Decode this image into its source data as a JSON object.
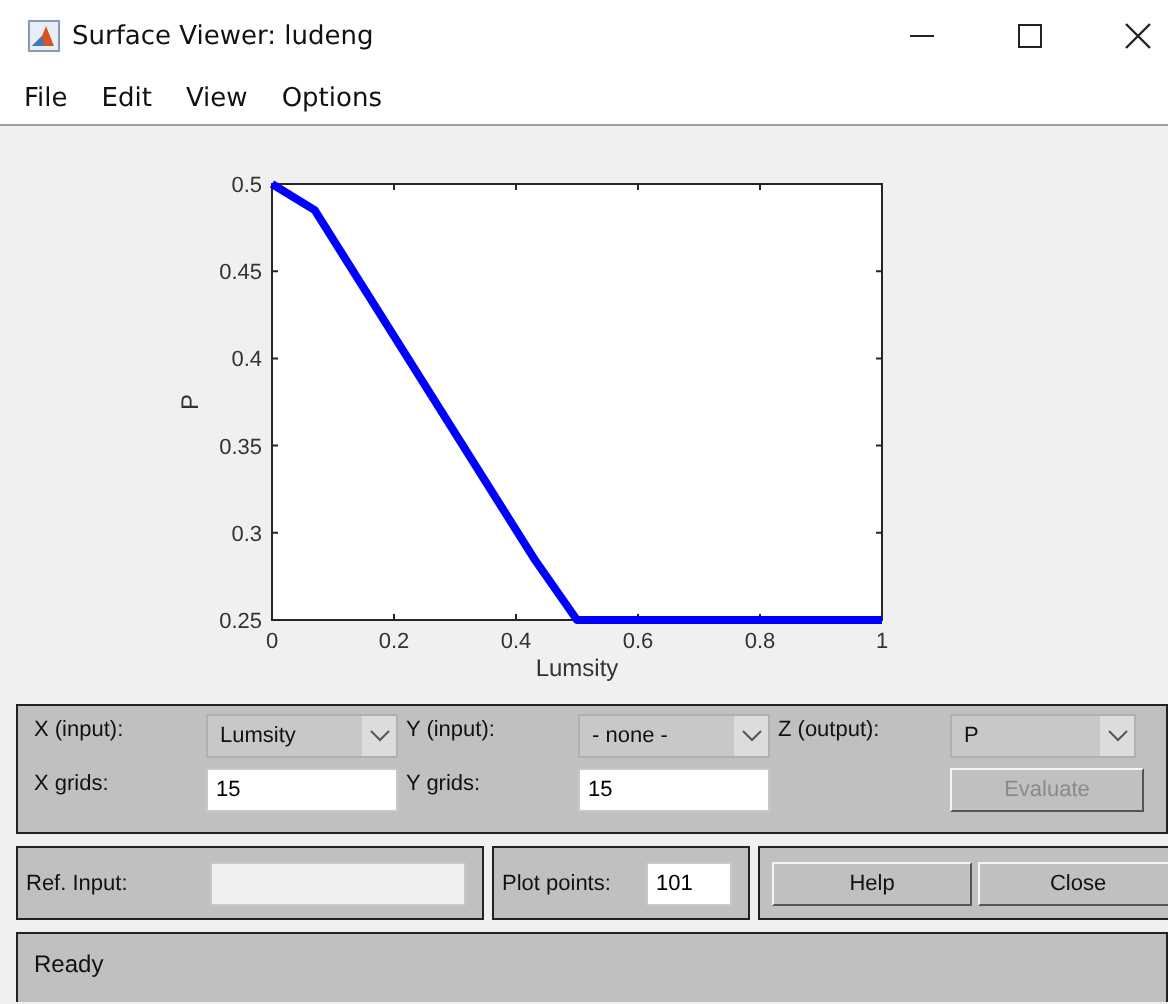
{
  "window": {
    "title": "Surface Viewer: ludeng"
  },
  "menu": [
    "File",
    "Edit",
    "View",
    "Options"
  ],
  "plot": {
    "chart_data": {
      "type": "line",
      "xlabel": "Lumsity",
      "ylabel": "P",
      "xlim": [
        0,
        1
      ],
      "ylim": [
        0.25,
        0.5
      ],
      "xticks": [
        0,
        0.2,
        0.4,
        0.6,
        0.8,
        1
      ],
      "yticks": [
        0.25,
        0.3,
        0.35,
        0.4,
        0.45,
        0.5
      ],
      "x": [
        0,
        0.07,
        0.43,
        0.5,
        1
      ],
      "series": [
        {
          "color": "#0000ff",
          "values": [
            0.5,
            0.485,
            0.285,
            0.25,
            0.25
          ]
        }
      ]
    }
  },
  "axes": {
    "x": {
      "label": "X (input):",
      "value": "Lumsity"
    },
    "y": {
      "label": "Y (input):",
      "value": "- none -"
    },
    "z": {
      "label": "Z (output):",
      "value": "P"
    }
  },
  "grids": {
    "x": {
      "label": "X grids:",
      "value": "15"
    },
    "y": {
      "label": "Y grids:",
      "value": "15"
    }
  },
  "evaluate": {
    "label": "Evaluate",
    "disabled": true
  },
  "ref_input": {
    "label": "Ref. Input:",
    "disabled": true
  },
  "plot_points": {
    "label": "Plot points:",
    "value": "101"
  },
  "buttons": [
    "Help",
    "Close"
  ],
  "status": "Ready"
}
